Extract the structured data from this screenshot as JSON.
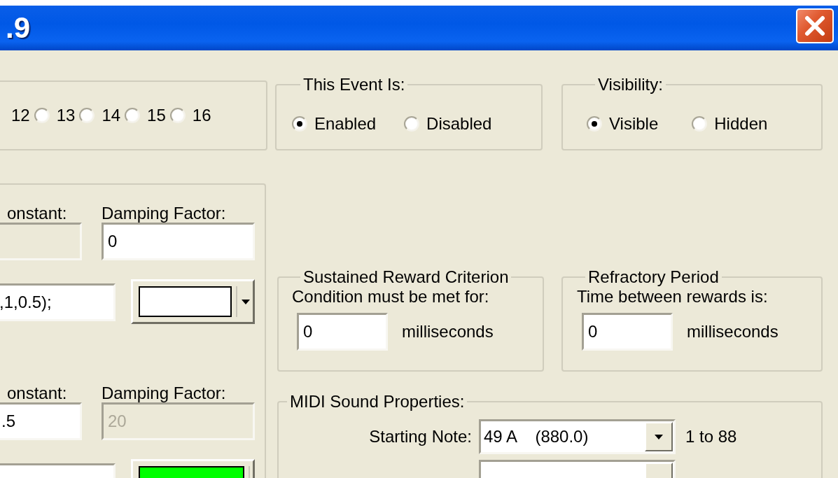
{
  "window": {
    "title": ".9"
  },
  "channel_group": {
    "cut_label": "12",
    "options": [
      {
        "label": "13",
        "selected": false
      },
      {
        "label": "14",
        "selected": false
      },
      {
        "label": "15",
        "selected": false
      },
      {
        "label": "16",
        "selected": false
      }
    ]
  },
  "event_state": {
    "legend": "This Event Is:",
    "options": [
      {
        "label": "Enabled",
        "selected": true
      },
      {
        "label": "Disabled",
        "selected": false
      }
    ]
  },
  "visibility": {
    "legend": "Visibility:",
    "options": [
      {
        "label": "Visible",
        "selected": true
      },
      {
        "label": "Hidden",
        "selected": false
      }
    ]
  },
  "left_panel": {
    "sections": [
      {
        "constant_label": "onstant:",
        "constant_disabled": true,
        "damping_label": "Damping Factor:",
        "damping_value": "0",
        "damping_disabled": false,
        "expression": ",1,0.5);",
        "color": "#ffffff"
      },
      {
        "constant_label": "onstant:",
        "constant_value": ".5",
        "constant_disabled": false,
        "damping_label": "Damping Factor:",
        "damping_value": "20",
        "damping_disabled": true,
        "color": "#00ff00"
      }
    ]
  },
  "reward_criterion": {
    "legend": "Sustained Reward Criterion",
    "prompt": "Condition must be met for:",
    "value": "0",
    "unit": "milliseconds"
  },
  "refractory_period": {
    "legend": "Refractory Period",
    "prompt": "Time between rewards is:",
    "value": "0",
    "unit": "milliseconds"
  },
  "midi": {
    "legend": "MIDI Sound Properties:",
    "rows": [
      {
        "label": "Starting Note:",
        "value": "49 A    (880.0)",
        "range": "1 to 88"
      },
      {
        "kind": "cut"
      }
    ]
  }
}
